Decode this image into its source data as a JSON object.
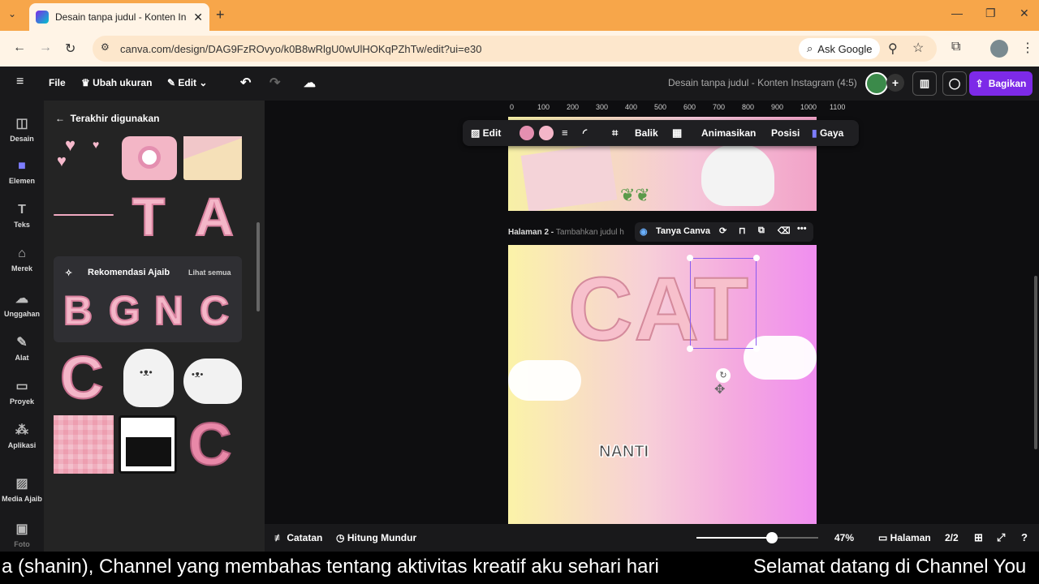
{
  "browser": {
    "tab_title": "Desain tanpa judul - Konten Ins",
    "url": "canva.com/design/DAG9FzROvyo/k0B8wRlgU0wUlHOKqPZhTw/edit?ui=e30",
    "ask_google": "Ask Google"
  },
  "toolbar": {
    "file": "File",
    "resize": "Ubah ukuran",
    "edit": "Edit",
    "doc_title": "Desain tanpa judul - Konten Instagram (4:5)",
    "share": "Bagikan"
  },
  "rail": {
    "items": [
      {
        "label": "Desain",
        "icon": "layout-icon"
      },
      {
        "label": "Elemen",
        "icon": "elements-icon"
      },
      {
        "label": "Teks",
        "icon": "text-icon"
      },
      {
        "label": "Merek",
        "icon": "brand-icon"
      },
      {
        "label": "Unggahan",
        "icon": "upload-icon"
      },
      {
        "label": "Alat",
        "icon": "pen-icon"
      },
      {
        "label": "Proyek",
        "icon": "folder-icon"
      },
      {
        "label": "Aplikasi",
        "icon": "apps-icon"
      },
      {
        "label": "Media Ajaib",
        "icon": "magic-media-icon"
      },
      {
        "label": "Foto",
        "icon": "photo-icon"
      }
    ]
  },
  "panel": {
    "back_title": "Terakhir digunakan",
    "reco_title": "Rekomendasi Ajaib",
    "see_all": "Lihat semua",
    "letters": [
      "B",
      "G",
      "N",
      "C"
    ],
    "tiles_top": [
      "T",
      "A"
    ],
    "tile_c": "C"
  },
  "canvas": {
    "ruler_ticks": [
      "0",
      "100",
      "200",
      "300",
      "400",
      "500",
      "600",
      "700",
      "800",
      "900",
      "1000",
      "1100"
    ],
    "page2_label": "Halaman 2 -",
    "page2_hint": "Tambahkan judul h",
    "ask_canva": "Tanya Canva",
    "cat_text": "CAT",
    "nanti_text": "NANTI"
  },
  "floatbar": {
    "edit": "Edit",
    "flip": "Balik",
    "animate": "Animasikan",
    "position": "Posisi",
    "style": "Gaya",
    "colors": [
      "#e48fb0",
      "#f4b6c8"
    ]
  },
  "bottom": {
    "notes": "Catatan",
    "timer": "Hitung Mundur",
    "zoom": "47%",
    "pages_label": "Halaman",
    "page_count": "2/2",
    "zoom_level": 0.62
  },
  "caption": {
    "left": "a (shanin), Channel yang membahas tentang aktivitas kreatif aku sehari hari",
    "right": "Selamat datang di Channel You"
  },
  "colors": {
    "brand_purple": "#7d2ae8",
    "chrome_orange": "#f7a64a"
  }
}
